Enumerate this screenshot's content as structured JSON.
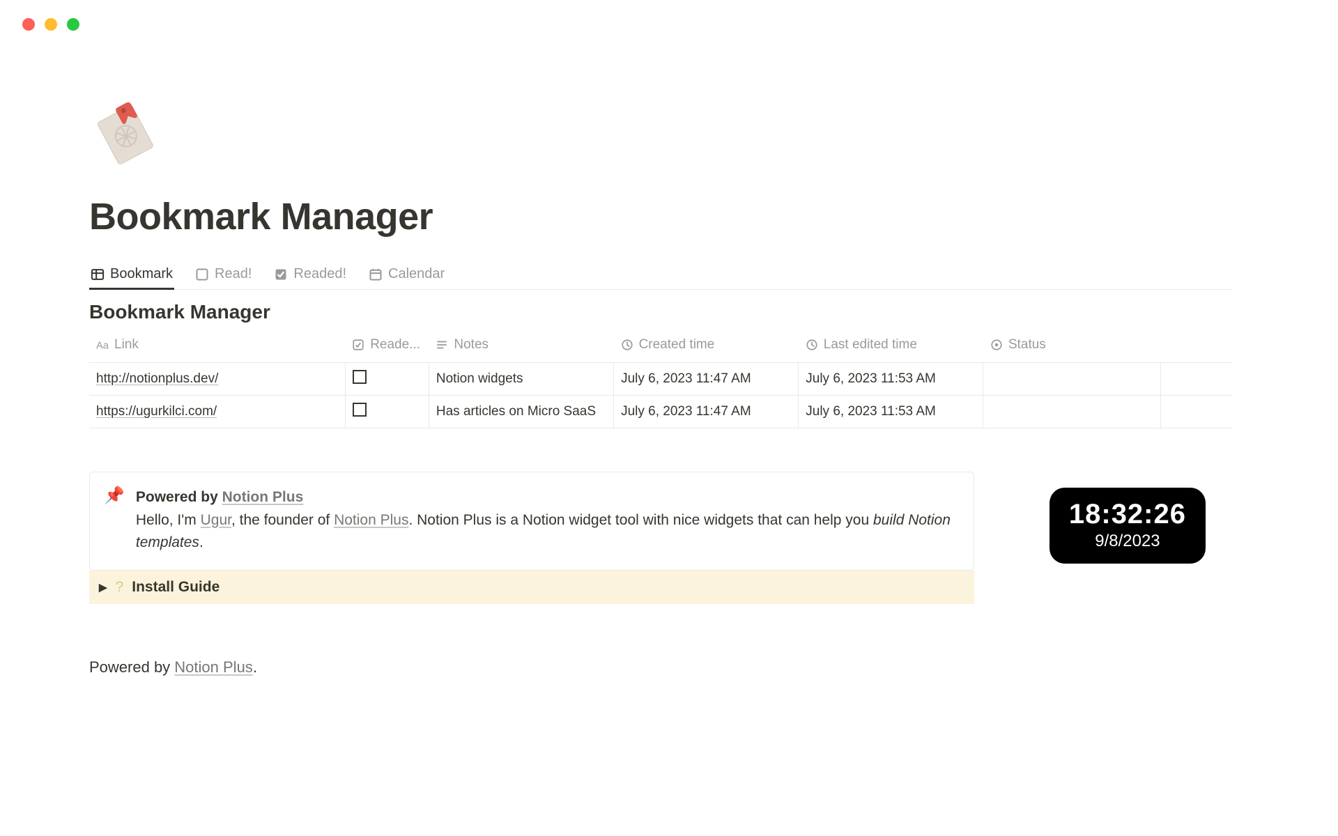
{
  "page_title": "Bookmark Manager",
  "icon_name": "bookmark-tag-icon",
  "tabs": [
    {
      "label": "Bookmark",
      "icon": "table-icon",
      "active": true
    },
    {
      "label": "Read!",
      "icon": "checkbox-off-icon",
      "active": false
    },
    {
      "label": "Readed!",
      "icon": "checkbox-on-icon",
      "active": false
    },
    {
      "label": "Calendar",
      "icon": "calendar-icon",
      "active": false
    }
  ],
  "database": {
    "title": "Bookmark Manager",
    "columns": [
      {
        "label": "Link",
        "icon": "title-icon"
      },
      {
        "label": "Reade...",
        "icon": "checkbox-on-icon"
      },
      {
        "label": "Notes",
        "icon": "lines-icon"
      },
      {
        "label": "Created time",
        "icon": "clock-icon"
      },
      {
        "label": "Last edited time",
        "icon": "clock-icon"
      },
      {
        "label": "Status",
        "icon": "status-icon"
      }
    ],
    "rows": [
      {
        "link": "http://notionplus.dev/",
        "readed": false,
        "notes": "Notion widgets",
        "created": "July 6, 2023 11:47 AM",
        "edited": "July 6, 2023 11:53 AM",
        "status": ""
      },
      {
        "link": "https://ugurkilci.com/",
        "readed": false,
        "notes": "Has articles on Micro SaaS",
        "created": "July 6, 2023 11:47 AM",
        "edited": "July 6, 2023 11:53 AM",
        "status": ""
      }
    ]
  },
  "callout": {
    "icon": "📌",
    "title_prefix": "Powered by ",
    "title_link": "Notion Plus",
    "text_1": "Hello, I'm ",
    "author_link": "Ugur",
    "text_2": ", the founder of ",
    "brand_link": "Notion Plus",
    "text_3": ". Notion Plus is a Notion widget tool with nice widgets that can help you ",
    "italic": "build Notion templates",
    "text_4": "."
  },
  "toggle": {
    "label": "Install Guide"
  },
  "footer": {
    "prefix": "Powered by ",
    "link": "Notion Plus",
    "suffix": "."
  },
  "clock": {
    "time": "18:32:26",
    "date": "9/8/2023"
  }
}
